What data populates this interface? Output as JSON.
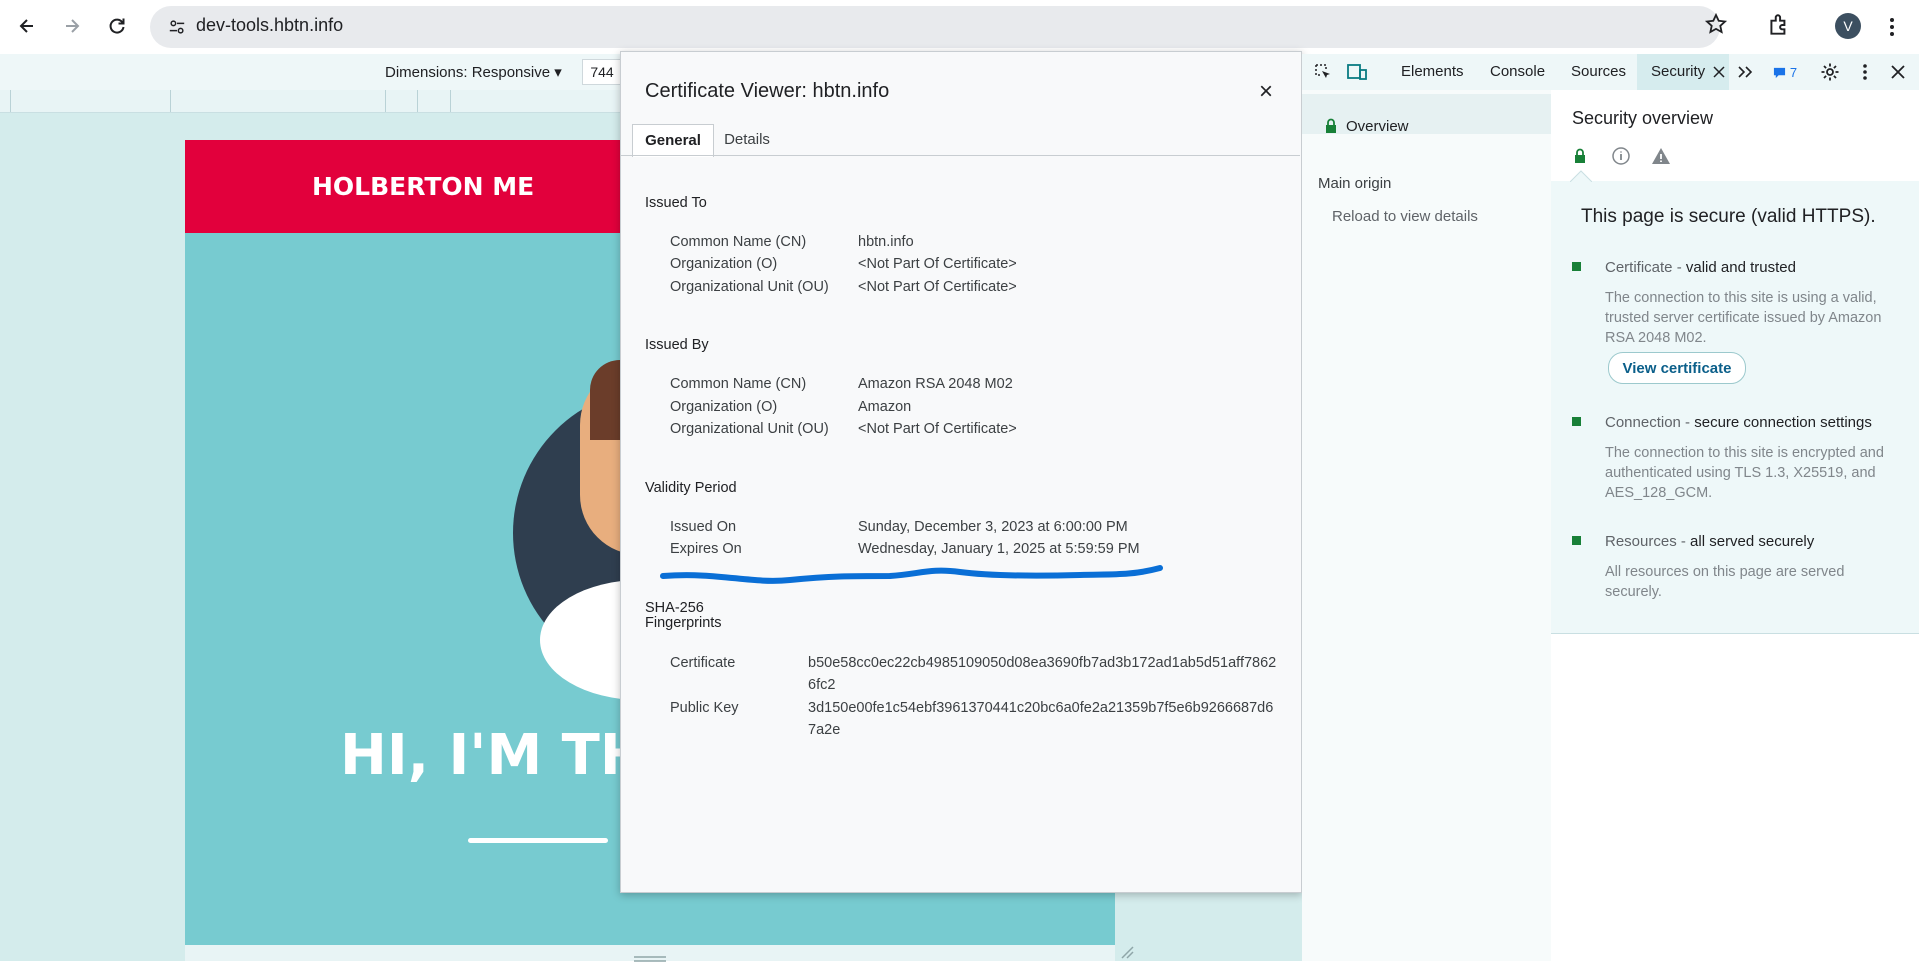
{
  "browser": {
    "url": "dev-tools.hbtn.info",
    "avatar_letter": "V"
  },
  "device_toolbar": {
    "dimensions_label": "Dimensions: Responsive ▾",
    "width_value": "744"
  },
  "viewport": {
    "brand": "HOLBERTON ME",
    "headline": "HI, I'M THI"
  },
  "certificate_viewer": {
    "title": "Certificate Viewer: hbtn.info",
    "close_glyph": "×",
    "tabs": [
      "General",
      "Details"
    ],
    "issued_to": {
      "heading": "Issued To",
      "rows": [
        {
          "label": "Common Name (CN)",
          "value": "hbtn.info"
        },
        {
          "label": "Organization (O)",
          "value": "<Not Part Of Certificate>"
        },
        {
          "label": "Organizational Unit (OU)",
          "value": "<Not Part Of Certificate>"
        }
      ]
    },
    "issued_by": {
      "heading": "Issued By",
      "rows": [
        {
          "label": "Common Name (CN)",
          "value": "Amazon RSA 2048 M02"
        },
        {
          "label": "Organization (O)",
          "value": "Amazon"
        },
        {
          "label": "Organizational Unit (OU)",
          "value": "<Not Part Of Certificate>"
        }
      ]
    },
    "validity": {
      "heading": "Validity Period",
      "rows": [
        {
          "label": "Issued On",
          "value": "Sunday, December 3, 2023 at 6:00:00 PM"
        },
        {
          "label": "Expires On",
          "value": "Wednesday, January 1, 2025 at 5:59:59 PM"
        }
      ]
    },
    "fingerprints": {
      "heading_line1": "SHA-256",
      "heading_line2": "Fingerprints",
      "rows": [
        {
          "label": "Certificate",
          "value": "b50e58cc0ec22cb4985109050d08ea3690fb7ad3b172ad1ab5d51aff78626fc2"
        },
        {
          "label": "Public Key",
          "value": "3d150e00fe1c54ebf3961370441c20bc6a0fe2a21359b7f5e6b9266687d67a2e"
        }
      ]
    },
    "annotation_color": "#0a6fd6"
  },
  "devtools": {
    "tabs": [
      "Elements",
      "Console",
      "Sources",
      "Security"
    ],
    "issues_count": "7",
    "sidebar": {
      "overview": "Overview",
      "main_origin": "Main origin",
      "reload_hint": "Reload to view details"
    },
    "overview_title": "Security overview",
    "secure_text": "This page is secure (valid HTTPS).",
    "items": [
      {
        "title": "Certificate",
        "status": "valid and trusted",
        "description": "The connection to this site is using a valid, trusted server certificate issued by Amazon RSA 2048 M02."
      },
      {
        "title": "Connection",
        "status": "secure connection settings",
        "description": "The connection to this site is encrypted and authenticated using TLS 1.3, X25519, and AES_128_GCM."
      },
      {
        "title": "Resources",
        "status": "all served securely",
        "description": "All resources on this page are served securely."
      }
    ],
    "view_certificate_label": "View certificate",
    "colors": {
      "secure": "#188038",
      "accent": "#0a7b83"
    }
  }
}
